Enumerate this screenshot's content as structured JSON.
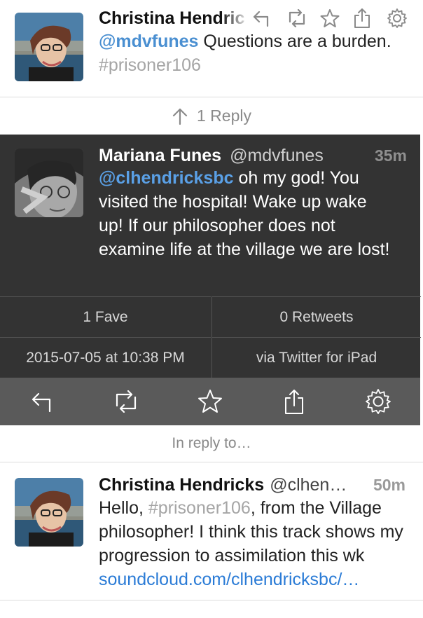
{
  "top_tweet": {
    "author_name": "Christina Hendric",
    "mention": "@mdvfunes",
    "text_1": " Questions are a burden. ",
    "hashtag": "#prisoner106",
    "action_icons": [
      "reply-icon",
      "retweet-icon",
      "favorite-icon",
      "share-icon",
      "settings-icon"
    ]
  },
  "reply_row": {
    "icon": "arrow-up-icon",
    "label": "1 Reply"
  },
  "focused_tweet": {
    "author_name": "Mariana Funes",
    "handle": "@mdvfunes",
    "time": "35m",
    "mention": "@clhendricksbc",
    "text": " oh my god! You visited the hospital! Wake up wake up! If our philosopher does not examine life at the village we are lost!",
    "stats": {
      "faves": "1 Fave",
      "retweets": "0 Retweets",
      "timestamp": "2015-07-05 at 10:38 PM",
      "source": "via Twitter for iPad"
    },
    "toolbar_icons": [
      "reply-icon",
      "retweet-icon",
      "favorite-icon",
      "share-icon",
      "settings-icon"
    ]
  },
  "in_reply_to": {
    "label": "In reply to…"
  },
  "bottom_tweet": {
    "author_name": "Christina Hendricks",
    "handle": "@clhen…",
    "time": "50m",
    "text_1": "Hello, ",
    "hashtag": "#prisoner106",
    "text_2": ", from the Village philosopher! I think this track shows my progression to assimilation this wk ",
    "link": "soundcloud.com/clhendricksbc/…"
  },
  "colors": {
    "mention_blue": "#4a8fd1",
    "link_blue": "#2a7bd6",
    "dark_background": "#333333",
    "toolbar_background": "#5a5a5a"
  }
}
